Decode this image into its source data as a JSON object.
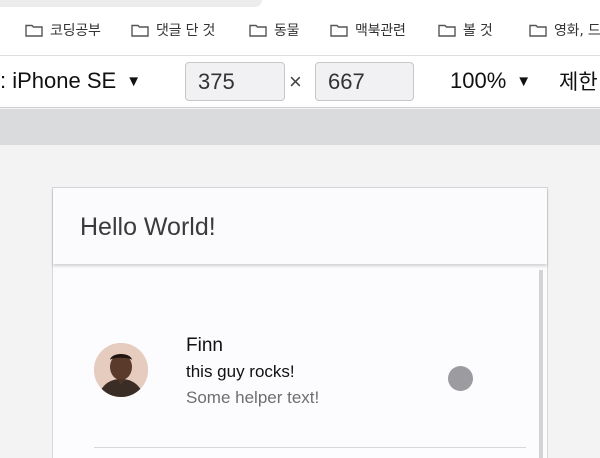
{
  "bookmarks": [
    {
      "label": "코딩공부",
      "icon": "folder-icon"
    },
    {
      "label": "댓글 단 것",
      "icon": "folder-icon"
    },
    {
      "label": "동물",
      "icon": "folder-icon"
    },
    {
      "label": "맥북관련",
      "icon": "folder-icon"
    },
    {
      "label": "볼 것",
      "icon": "folder-icon"
    },
    {
      "label": "영화, 드",
      "icon": "folder-icon"
    }
  ],
  "device_toolbar": {
    "device": ": iPhone SE",
    "caret": "▼",
    "width": "375",
    "height": "667",
    "times": "×",
    "zoom": "100%",
    "throttle": "제한"
  },
  "app": {
    "title": "Hello World!",
    "item": {
      "name": "Finn",
      "secondary": "this guy rocks!",
      "helper": "Some helper text!"
    }
  },
  "colors": {
    "status_dot": "#9c9b9f",
    "header_bg": "#fbfbfd"
  }
}
